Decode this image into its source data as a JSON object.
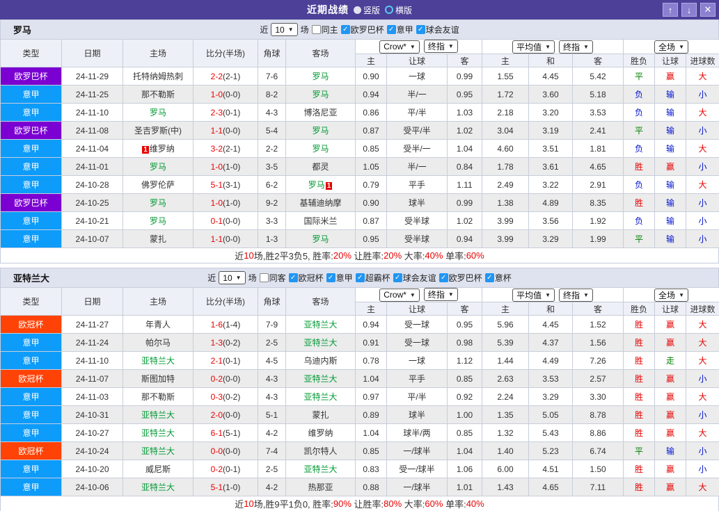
{
  "titlebar": {
    "title": "近期战绩",
    "radios": [
      {
        "label": "竖版",
        "selected": false
      },
      {
        "label": "横版",
        "selected": true
      }
    ],
    "buttons": {
      "up": "↑",
      "down": "↓",
      "close": "✕"
    }
  },
  "icons": {
    "check": "✓",
    "chevron": "▼"
  },
  "colors": {
    "titlebar_purple": "#4c4099",
    "europa": "#7b00d2",
    "seriea": "#0d9cfa",
    "ucl": "#ff4206",
    "score_red": "#e60000",
    "team_green": "#009933",
    "result_red": "#e60000",
    "result_green": "#008000",
    "result_blue": "#0011cc",
    "summary_red": "#e60000",
    "checkbox_blue": "#2196f3"
  },
  "filter_labels": {
    "near": "近",
    "games": "场"
  },
  "table_header": {
    "static_cols": [
      "类型",
      "日期",
      "主场",
      "比分(半场)",
      "角球",
      "客场"
    ],
    "crow_dropdown": "Crow*",
    "final_dropdown": "终指",
    "avg_dropdown": "平均值",
    "full_dropdown": "全场",
    "crow_cols": [
      "主",
      "让球",
      "客"
    ],
    "avg_cols": [
      "主",
      "和",
      "客"
    ],
    "result_cols": [
      "胜负",
      "让球",
      "进球数"
    ]
  },
  "sections": [
    {
      "team": "罗马",
      "count": "10",
      "checkboxes": [
        {
          "label": "同主",
          "checked": false
        },
        {
          "label": "欧罗巴杯",
          "checked": true
        },
        {
          "label": "意甲",
          "checked": true
        },
        {
          "label": "球会友谊",
          "checked": true
        }
      ],
      "rows": [
        {
          "league": "欧罗巴杯",
          "lt": "europa",
          "date": "24-11-29",
          "home": {
            "name": "托特纳姆热刺"
          },
          "ft": "2-2",
          "ht": "(2-1)",
          "corner": "7-6",
          "away": {
            "name": "罗马",
            "green": true
          },
          "crow": [
            "0.90",
            "一球",
            "0.99"
          ],
          "avg": [
            "1.55",
            "4.45",
            "5.42"
          ],
          "results": [
            {
              "t": "平",
              "c": "green"
            },
            {
              "t": "赢",
              "c": "red"
            },
            {
              "t": "大",
              "c": "red"
            }
          ]
        },
        {
          "league": "意甲",
          "lt": "seriea",
          "date": "24-11-25",
          "home": {
            "name": "那不勒斯"
          },
          "ft": "1-0",
          "ht": "(0-0)",
          "corner": "8-2",
          "away": {
            "name": "罗马",
            "green": true
          },
          "crow": [
            "0.94",
            "半/一",
            "0.95"
          ],
          "avg": [
            "1.72",
            "3.60",
            "5.18"
          ],
          "results": [
            {
              "t": "负",
              "c": "blue"
            },
            {
              "t": "输",
              "c": "blue"
            },
            {
              "t": "小",
              "c": "blue"
            }
          ]
        },
        {
          "league": "意甲",
          "lt": "seriea",
          "date": "24-11-10",
          "home": {
            "name": "罗马",
            "green": true
          },
          "ft": "2-3",
          "ht": "(0-1)",
          "corner": "4-3",
          "away": {
            "name": "博洛尼亚"
          },
          "crow": [
            "0.86",
            "平/半",
            "1.03"
          ],
          "avg": [
            "2.18",
            "3.20",
            "3.53"
          ],
          "results": [
            {
              "t": "负",
              "c": "blue"
            },
            {
              "t": "输",
              "c": "blue"
            },
            {
              "t": "大",
              "c": "red"
            }
          ]
        },
        {
          "league": "欧罗巴杯",
          "lt": "europa",
          "date": "24-11-08",
          "home": {
            "name": "圣吉罗斯(中)"
          },
          "ft": "1-1",
          "ht": "(0-0)",
          "corner": "5-4",
          "away": {
            "name": "罗马",
            "green": true
          },
          "crow": [
            "0.87",
            "受平/半",
            "1.02"
          ],
          "avg": [
            "3.04",
            "3.19",
            "2.41"
          ],
          "results": [
            {
              "t": "平",
              "c": "green"
            },
            {
              "t": "输",
              "c": "blue"
            },
            {
              "t": "小",
              "c": "blue"
            }
          ]
        },
        {
          "league": "意甲",
          "lt": "seriea",
          "date": "24-11-04",
          "home": {
            "name": "维罗纳",
            "card": "1",
            "card_pos": "before"
          },
          "ft": "3-2",
          "ht": "(2-1)",
          "corner": "2-2",
          "away": {
            "name": "罗马",
            "green": true
          },
          "crow": [
            "0.85",
            "受半/一",
            "1.04"
          ],
          "avg": [
            "4.60",
            "3.51",
            "1.81"
          ],
          "results": [
            {
              "t": "负",
              "c": "blue"
            },
            {
              "t": "输",
              "c": "blue"
            },
            {
              "t": "大",
              "c": "red"
            }
          ]
        },
        {
          "league": "意甲",
          "lt": "seriea",
          "date": "24-11-01",
          "home": {
            "name": "罗马",
            "green": true
          },
          "ft": "1-0",
          "ht": "(1-0)",
          "corner": "3-5",
          "away": {
            "name": "都灵"
          },
          "crow": [
            "1.05",
            "半/一",
            "0.84"
          ],
          "avg": [
            "1.78",
            "3.61",
            "4.65"
          ],
          "results": [
            {
              "t": "胜",
              "c": "red"
            },
            {
              "t": "赢",
              "c": "red"
            },
            {
              "t": "小",
              "c": "blue"
            }
          ]
        },
        {
          "league": "意甲",
          "lt": "seriea",
          "date": "24-10-28",
          "home": {
            "name": "佛罗伦萨"
          },
          "ft": "5-1",
          "ht": "(3-1)",
          "corner": "6-2",
          "away": {
            "name": "罗马",
            "green": true,
            "card": "1",
            "card_pos": "after"
          },
          "crow": [
            "0.79",
            "平手",
            "1.11"
          ],
          "avg": [
            "2.49",
            "3.22",
            "2.91"
          ],
          "results": [
            {
              "t": "负",
              "c": "blue"
            },
            {
              "t": "输",
              "c": "blue"
            },
            {
              "t": "大",
              "c": "red"
            }
          ]
        },
        {
          "league": "欧罗巴杯",
          "lt": "europa",
          "date": "24-10-25",
          "home": {
            "name": "罗马",
            "green": true
          },
          "ft": "1-0",
          "ht": "(1-0)",
          "corner": "9-2",
          "away": {
            "name": "基辅迪纳摩"
          },
          "crow": [
            "0.90",
            "球半",
            "0.99"
          ],
          "avg": [
            "1.38",
            "4.89",
            "8.35"
          ],
          "results": [
            {
              "t": "胜",
              "c": "red"
            },
            {
              "t": "输",
              "c": "blue"
            },
            {
              "t": "小",
              "c": "blue"
            }
          ]
        },
        {
          "league": "意甲",
          "lt": "seriea",
          "date": "24-10-21",
          "home": {
            "name": "罗马",
            "green": true
          },
          "ft": "0-1",
          "ht": "(0-0)",
          "corner": "3-3",
          "away": {
            "name": "国际米兰"
          },
          "crow": [
            "0.87",
            "受半球",
            "1.02"
          ],
          "avg": [
            "3.99",
            "3.56",
            "1.92"
          ],
          "results": [
            {
              "t": "负",
              "c": "blue"
            },
            {
              "t": "输",
              "c": "blue"
            },
            {
              "t": "小",
              "c": "blue"
            }
          ]
        },
        {
          "league": "意甲",
          "lt": "seriea",
          "date": "24-10-07",
          "home": {
            "name": "蒙扎"
          },
          "ft": "1-1",
          "ht": "(0-0)",
          "corner": "1-3",
          "away": {
            "name": "罗马",
            "green": true
          },
          "crow": [
            "0.95",
            "受半球",
            "0.94"
          ],
          "avg": [
            "3.99",
            "3.29",
            "1.99"
          ],
          "results": [
            {
              "t": "平",
              "c": "green"
            },
            {
              "t": "输",
              "c": "blue"
            },
            {
              "t": "小",
              "c": "blue"
            }
          ]
        }
      ],
      "summary": [
        {
          "t": "近",
          "c": "d"
        },
        {
          "t": "10",
          "c": "r"
        },
        {
          "t": "场,胜2平3负5, 胜率:",
          "c": "d"
        },
        {
          "t": "20%",
          "c": "r"
        },
        {
          "t": " 让胜率:",
          "c": "d"
        },
        {
          "t": "20%",
          "c": "r"
        },
        {
          "t": " 大率:",
          "c": "d"
        },
        {
          "t": "40%",
          "c": "r"
        },
        {
          "t": " 单率:",
          "c": "d"
        },
        {
          "t": "60%",
          "c": "r"
        }
      ]
    },
    {
      "team": "亚特兰大",
      "count": "10",
      "checkboxes": [
        {
          "label": "同客",
          "checked": false
        },
        {
          "label": "欧冠杯",
          "checked": true
        },
        {
          "label": "意甲",
          "checked": true
        },
        {
          "label": "超霸杯",
          "checked": true
        },
        {
          "label": "球会友谊",
          "checked": true
        },
        {
          "label": "欧罗巴杯",
          "checked": true
        },
        {
          "label": "意杯",
          "checked": true
        }
      ],
      "rows": [
        {
          "league": "欧冠杯",
          "lt": "ucl",
          "date": "24-11-27",
          "home": {
            "name": "年青人"
          },
          "ft": "1-6",
          "ht": "(1-4)",
          "corner": "7-9",
          "away": {
            "name": "亚特兰大",
            "green": true
          },
          "crow": [
            "0.94",
            "受一球",
            "0.95"
          ],
          "avg": [
            "5.96",
            "4.45",
            "1.52"
          ],
          "results": [
            {
              "t": "胜",
              "c": "red"
            },
            {
              "t": "赢",
              "c": "red"
            },
            {
              "t": "大",
              "c": "red"
            }
          ]
        },
        {
          "league": "意甲",
          "lt": "seriea",
          "date": "24-11-24",
          "home": {
            "name": "帕尔马"
          },
          "ft": "1-3",
          "ht": "(0-2)",
          "corner": "2-5",
          "away": {
            "name": "亚特兰大",
            "green": true
          },
          "crow": [
            "0.91",
            "受一球",
            "0.98"
          ],
          "avg": [
            "5.39",
            "4.37",
            "1.56"
          ],
          "results": [
            {
              "t": "胜",
              "c": "red"
            },
            {
              "t": "赢",
              "c": "red"
            },
            {
              "t": "大",
              "c": "red"
            }
          ]
        },
        {
          "league": "意甲",
          "lt": "seriea",
          "date": "24-11-10",
          "home": {
            "name": "亚特兰大",
            "green": true
          },
          "ft": "2-1",
          "ht": "(0-1)",
          "corner": "4-5",
          "away": {
            "name": "乌迪内斯"
          },
          "crow": [
            "0.78",
            "一球",
            "1.12"
          ],
          "avg": [
            "1.44",
            "4.49",
            "7.26"
          ],
          "results": [
            {
              "t": "胜",
              "c": "red"
            },
            {
              "t": "走",
              "c": "green"
            },
            {
              "t": "大",
              "c": "red"
            }
          ]
        },
        {
          "league": "欧冠杯",
          "lt": "ucl",
          "date": "24-11-07",
          "home": {
            "name": "斯图加特"
          },
          "ft": "0-2",
          "ht": "(0-0)",
          "corner": "4-3",
          "away": {
            "name": "亚特兰大",
            "green": true
          },
          "crow": [
            "1.04",
            "平手",
            "0.85"
          ],
          "avg": [
            "2.63",
            "3.53",
            "2.57"
          ],
          "results": [
            {
              "t": "胜",
              "c": "red"
            },
            {
              "t": "赢",
              "c": "red"
            },
            {
              "t": "小",
              "c": "blue"
            }
          ]
        },
        {
          "league": "意甲",
          "lt": "seriea",
          "date": "24-11-03",
          "home": {
            "name": "那不勒斯"
          },
          "ft": "0-3",
          "ht": "(0-2)",
          "corner": "4-3",
          "away": {
            "name": "亚特兰大",
            "green": true
          },
          "crow": [
            "0.97",
            "平/半",
            "0.92"
          ],
          "avg": [
            "2.24",
            "3.29",
            "3.30"
          ],
          "results": [
            {
              "t": "胜",
              "c": "red"
            },
            {
              "t": "赢",
              "c": "red"
            },
            {
              "t": "大",
              "c": "red"
            }
          ]
        },
        {
          "league": "意甲",
          "lt": "seriea",
          "date": "24-10-31",
          "home": {
            "name": "亚特兰大",
            "green": true
          },
          "ft": "2-0",
          "ht": "(0-0)",
          "corner": "5-1",
          "away": {
            "name": "蒙扎"
          },
          "crow": [
            "0.89",
            "球半",
            "1.00"
          ],
          "avg": [
            "1.35",
            "5.05",
            "8.78"
          ],
          "results": [
            {
              "t": "胜",
              "c": "red"
            },
            {
              "t": "赢",
              "c": "red"
            },
            {
              "t": "小",
              "c": "blue"
            }
          ]
        },
        {
          "league": "意甲",
          "lt": "seriea",
          "date": "24-10-27",
          "home": {
            "name": "亚特兰大",
            "green": true
          },
          "ft": "6-1",
          "ht": "(5-1)",
          "corner": "4-2",
          "away": {
            "name": "维罗纳"
          },
          "crow": [
            "1.04",
            "球半/两",
            "0.85"
          ],
          "avg": [
            "1.32",
            "5.43",
            "8.86"
          ],
          "results": [
            {
              "t": "胜",
              "c": "red"
            },
            {
              "t": "赢",
              "c": "red"
            },
            {
              "t": "大",
              "c": "red"
            }
          ]
        },
        {
          "league": "欧冠杯",
          "lt": "ucl",
          "date": "24-10-24",
          "home": {
            "name": "亚特兰大",
            "green": true
          },
          "ft": "0-0",
          "ht": "(0-0)",
          "corner": "7-4",
          "away": {
            "name": "凯尔特人"
          },
          "crow": [
            "0.85",
            "一/球半",
            "1.04"
          ],
          "avg": [
            "1.40",
            "5.23",
            "6.74"
          ],
          "results": [
            {
              "t": "平",
              "c": "green"
            },
            {
              "t": "输",
              "c": "blue"
            },
            {
              "t": "小",
              "c": "blue"
            }
          ]
        },
        {
          "league": "意甲",
          "lt": "seriea",
          "date": "24-10-20",
          "home": {
            "name": "威尼斯"
          },
          "ft": "0-2",
          "ht": "(0-1)",
          "corner": "2-5",
          "away": {
            "name": "亚特兰大",
            "green": true
          },
          "crow": [
            "0.83",
            "受一/球半",
            "1.06"
          ],
          "avg": [
            "6.00",
            "4.51",
            "1.50"
          ],
          "results": [
            {
              "t": "胜",
              "c": "red"
            },
            {
              "t": "赢",
              "c": "red"
            },
            {
              "t": "小",
              "c": "blue"
            }
          ]
        },
        {
          "league": "意甲",
          "lt": "seriea",
          "date": "24-10-06",
          "home": {
            "name": "亚特兰大",
            "green": true
          },
          "ft": "5-1",
          "ht": "(1-0)",
          "corner": "4-2",
          "away": {
            "name": "热那亚"
          },
          "crow": [
            "0.88",
            "一/球半",
            "1.01"
          ],
          "avg": [
            "1.43",
            "4.65",
            "7.11"
          ],
          "results": [
            {
              "t": "胜",
              "c": "red"
            },
            {
              "t": "赢",
              "c": "red"
            },
            {
              "t": "大",
              "c": "red"
            }
          ]
        }
      ],
      "summary": [
        {
          "t": "近",
          "c": "d"
        },
        {
          "t": "10",
          "c": "r"
        },
        {
          "t": "场,胜9平1负0, 胜率:",
          "c": "d"
        },
        {
          "t": "90%",
          "c": "r"
        },
        {
          "t": " 让胜率:",
          "c": "d"
        },
        {
          "t": "80%",
          "c": "r"
        },
        {
          "t": " 大率:",
          "c": "d"
        },
        {
          "t": "60%",
          "c": "r"
        },
        {
          "t": " 单率:",
          "c": "d"
        },
        {
          "t": "40%",
          "c": "r"
        }
      ]
    }
  ]
}
